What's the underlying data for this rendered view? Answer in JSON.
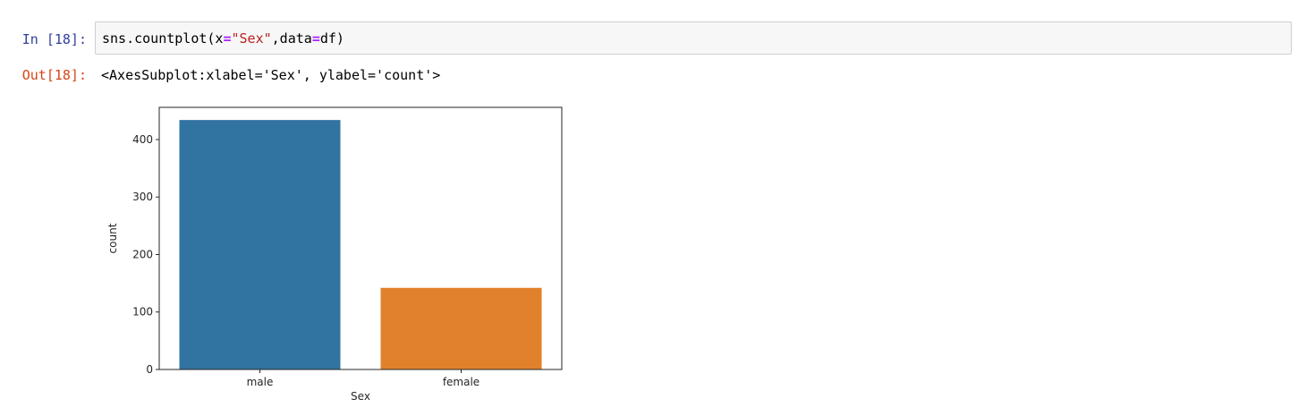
{
  "cell": {
    "in_prompt": "In [18]:",
    "out_prompt": "Out[18]:",
    "code": {
      "fn": "sns.countplot(x",
      "eq1": "=",
      "str": "\"Sex\"",
      "mid": ",data",
      "eq2": "=",
      "end": "df)"
    },
    "output_repr": "<AxesSubplot:xlabel='Sex', ylabel='count'>"
  },
  "colors": {
    "in_prompt": "#303f9f",
    "out_prompt": "#d84315",
    "code_operator": "#aa22ff",
    "code_string": "#ba2121"
  },
  "chart_data": {
    "type": "bar",
    "categories": [
      "male",
      "female"
    ],
    "values": [
      434,
      142
    ],
    "colors": [
      "#3274a1",
      "#e1812c"
    ],
    "xlabel": "Sex",
    "ylabel": "count",
    "ylim": [
      0,
      456
    ],
    "yticks": [
      0,
      100,
      200,
      300,
      400
    ],
    "grid": false,
    "legend": "none"
  }
}
